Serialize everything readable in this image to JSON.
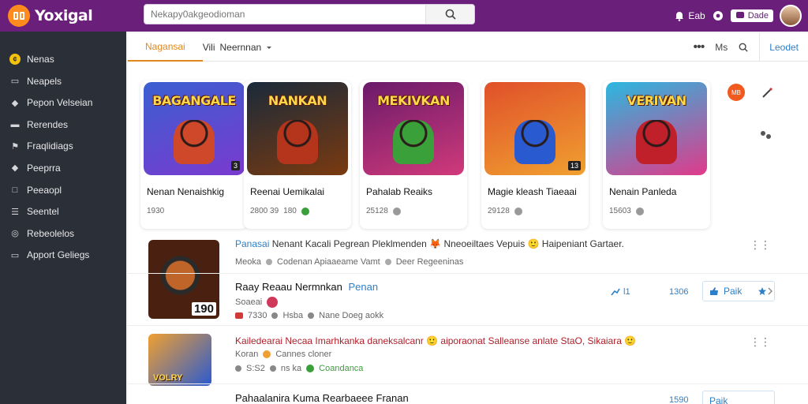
{
  "app": {
    "logo_mark": "ꟷ",
    "name": "Yoxigal"
  },
  "search": {
    "placeholder": "Nekapy0akgeodioman"
  },
  "topbar": {
    "item1": "Eab",
    "pill": "Dade"
  },
  "sidebar": {
    "items": [
      {
        "label": "Nenas",
        "icon": "coin-icon"
      },
      {
        "label": "Neapels",
        "icon": "document-icon"
      },
      {
        "label": "Pepon Velseian",
        "icon": "tag-icon"
      },
      {
        "label": "Rerendes",
        "icon": "layers-icon"
      },
      {
        "label": "Fraqlidiags",
        "icon": "flag-icon"
      },
      {
        "label": "Peeprra",
        "icon": "tag-icon"
      },
      {
        "label": "Peeaopl",
        "icon": "box-icon"
      },
      {
        "label": "Seentel",
        "icon": "list-icon"
      },
      {
        "label": "Rebeolelos",
        "icon": "globe-icon"
      },
      {
        "label": "Apport Geliegs",
        "icon": "document-icon"
      }
    ]
  },
  "tabs": [
    {
      "label": "Nagansai"
    },
    {
      "label": "Neernnan"
    }
  ],
  "tab2_prefix": "Vili",
  "header_right": {
    "ms": "Ms",
    "lnk": "Leodet"
  },
  "cards": [
    {
      "art_text": "BAGANGALE",
      "title": "Nenan Nenaishkig",
      "meta": "1930",
      "badge": "3",
      "colors": [
        "#3a5fd0",
        "#7a3ad0"
      ],
      "hero": "#d0482a"
    },
    {
      "art_text": "NANKAN",
      "title": "Reenai Uemikalai",
      "meta": "2800 39",
      "meta2": "180",
      "badge": "",
      "colors": [
        "#1a2a3a",
        "#7a3a10"
      ],
      "hero": "#b4341c"
    },
    {
      "art_text": "MEKIVKAN",
      "title": "Pahalab Reaiks",
      "meta": "25128",
      "badge": "",
      "colors": [
        "#6a1a6a",
        "#d03a7a"
      ],
      "hero": "#3aa03a"
    },
    {
      "art_text": "",
      "title": "Magie kleash Tiaeaai",
      "meta": "29128",
      "badge": "13",
      "colors": [
        "#e0502a",
        "#f0a030"
      ],
      "hero": "#2a5ad0"
    },
    {
      "art_text": "VERIVAN",
      "title": "Nenain Panleda",
      "meta": "15603",
      "badge": "",
      "colors": [
        "#2ab8e0",
        "#e03a8a"
      ],
      "hero": "#c0202a"
    }
  ],
  "rows": [
    {
      "head": "Panasai",
      "line1": "Nenant Kacali Pegrean Pleklmenden 🦊 Nneoeiltaes Vepuis 🙂 Haipeniant Gartaer.",
      "line2": [
        "Meoka",
        "Codenan Apiaaeame Vamt",
        "Deer Regeeninas"
      ]
    },
    {
      "title": "Raay Reaau Nermnkan",
      "title_link": "Penan",
      "sub": "Soaeai",
      "stats": [
        "7330",
        "Hsba",
        "Nane Doeg aokk"
      ],
      "stat_a": "l1",
      "stat_b": "1306",
      "button": "Paik",
      "badge": "190"
    },
    {
      "line1": "Kailedearai Necaa Imarhkanka daneksalcanr 🙂 aiporaonat Salleanse anlate StaO, Sikaiara 🙂",
      "line2": [
        "Koran",
        "Cannes cloner",
        "S:S2",
        "ns ka",
        "Coandanca"
      ]
    },
    {
      "title": "Pahaalanira Kuma Rearbaeee Franan",
      "stat_b": "1590",
      "button": "Paik"
    }
  ]
}
